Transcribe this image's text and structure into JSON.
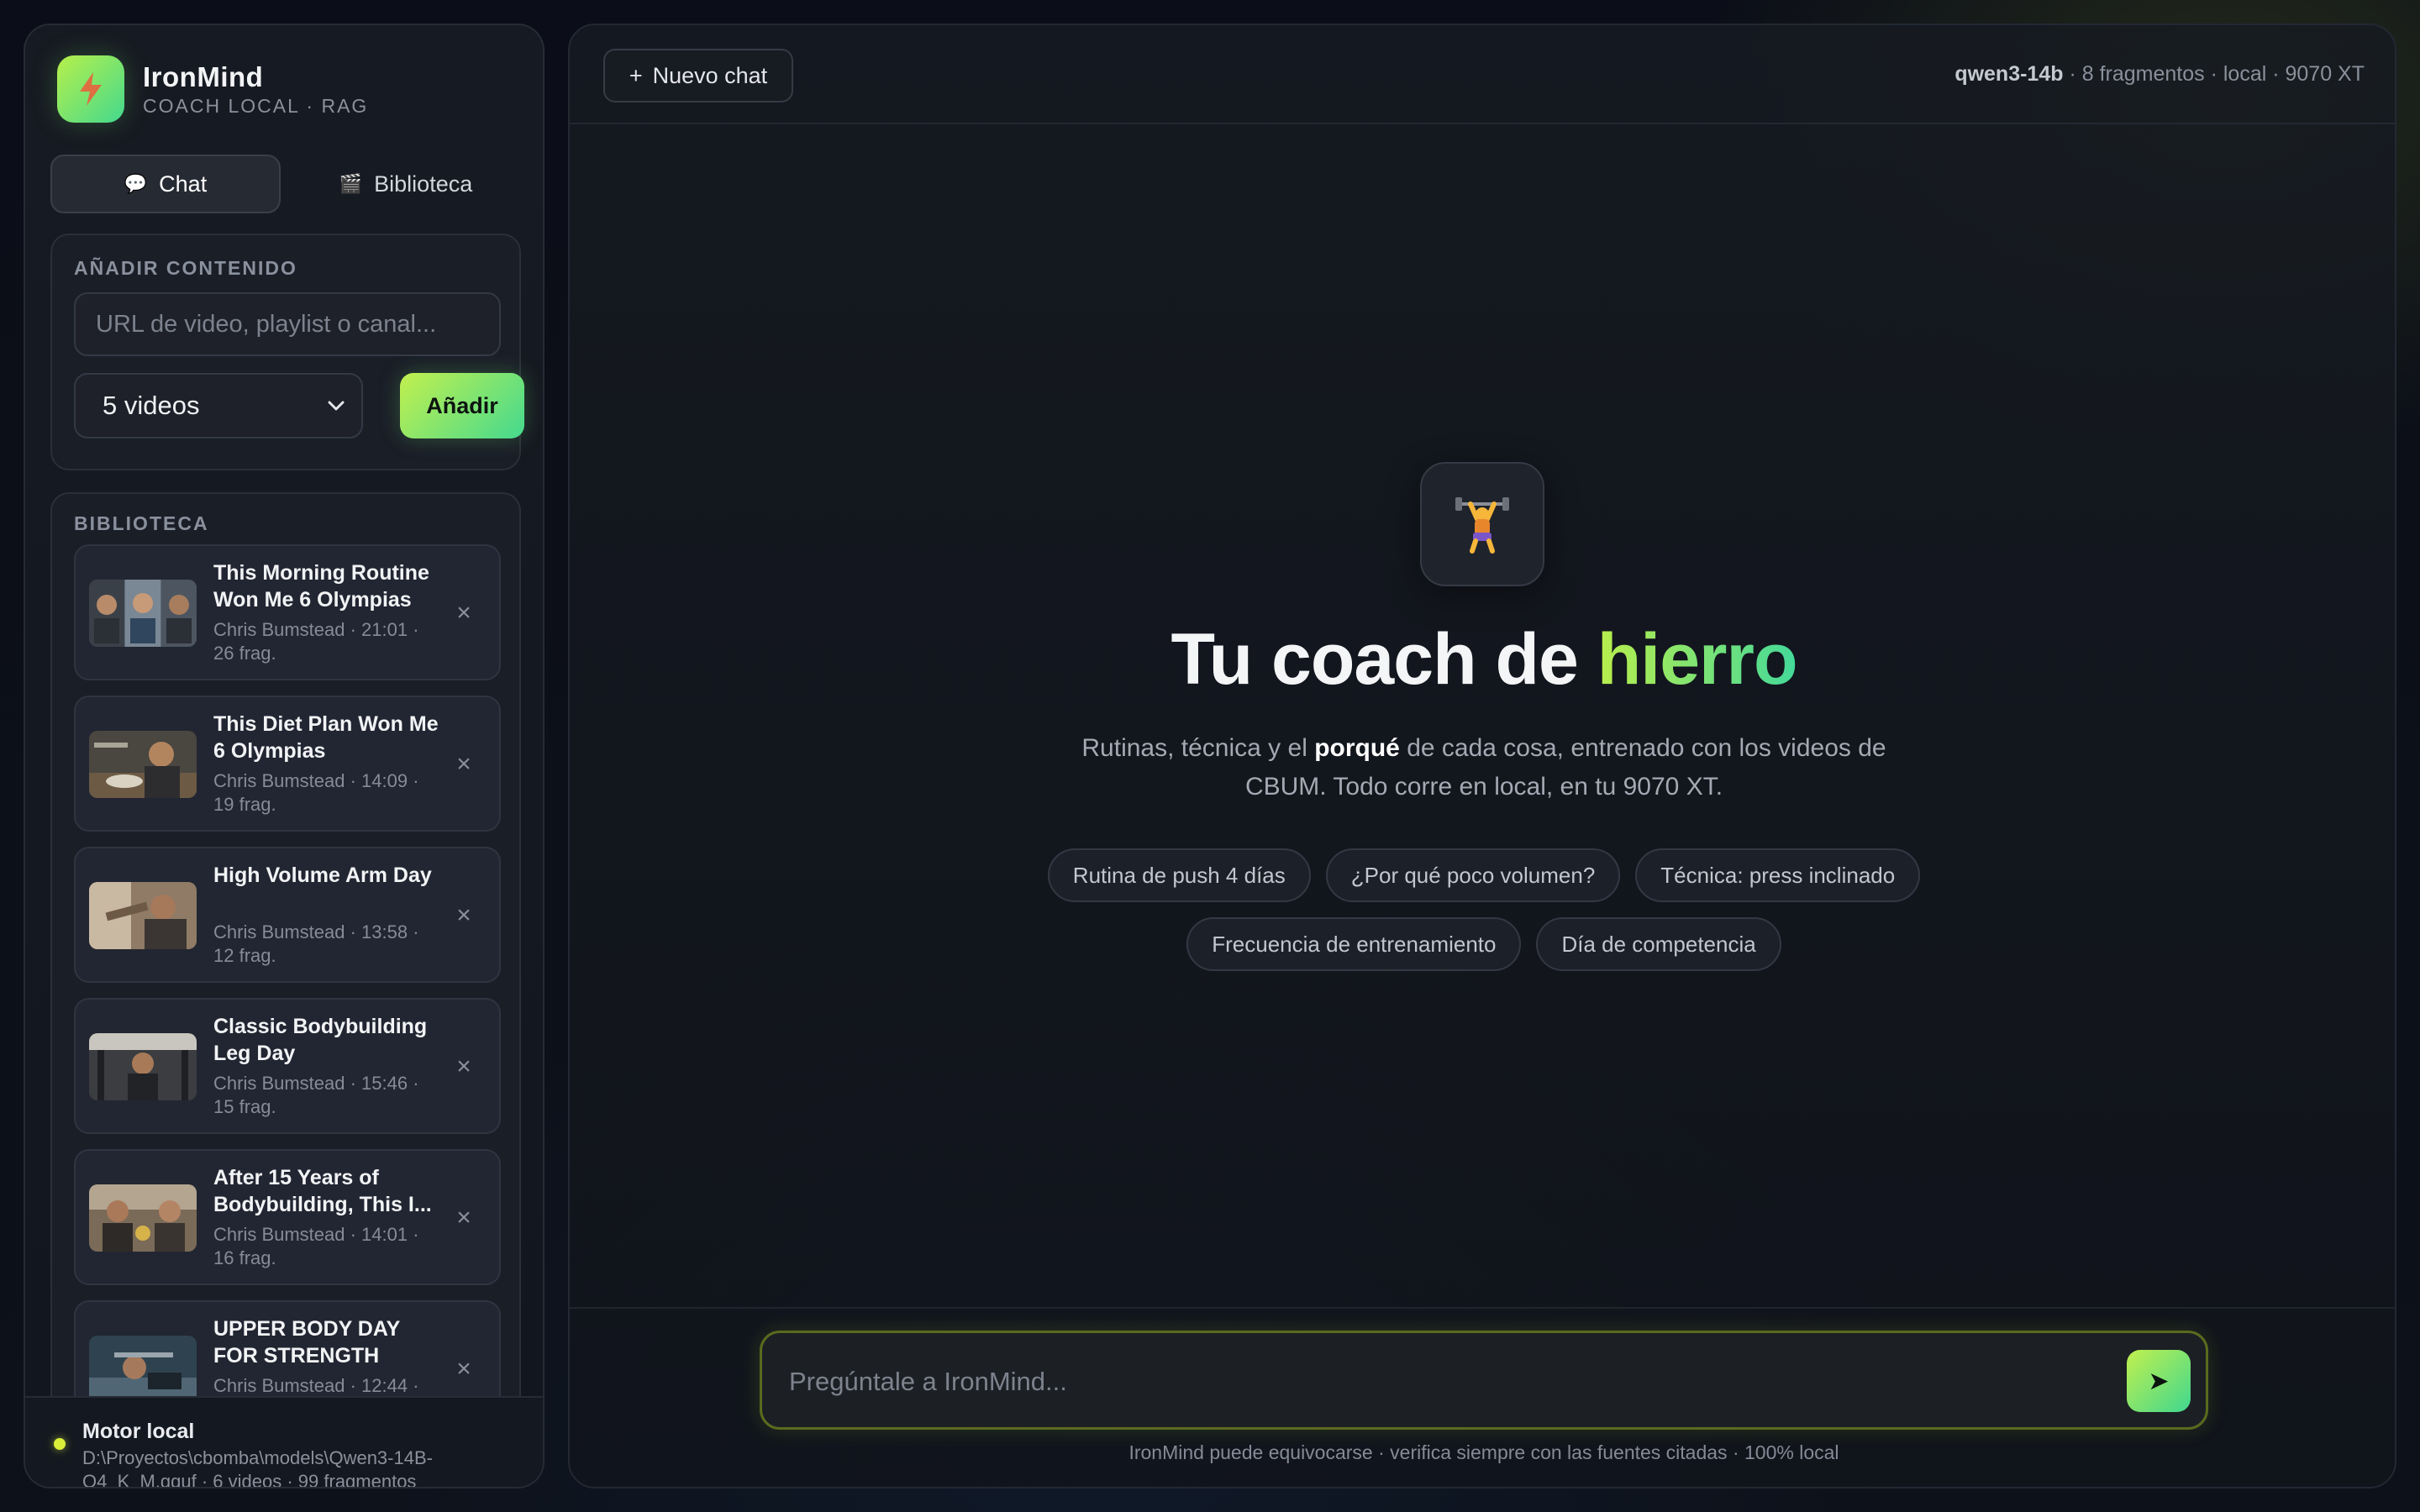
{
  "brand": {
    "name": "IronMind",
    "subtitle": "COACH LOCAL · RAG"
  },
  "tabs": [
    {
      "icon": "💬",
      "label": "Chat",
      "active": true
    },
    {
      "icon": "🎬",
      "label": "Biblioteca",
      "active": false
    }
  ],
  "add_content": {
    "label": "AÑADIR CONTENIDO",
    "url_placeholder": "URL de video, playlist o canal...",
    "url_value": "",
    "count_selected": "5 videos",
    "add_button": "Añadir"
  },
  "library": {
    "label": "BIBLIOTECA",
    "items": [
      {
        "title": "This Morning Routine Won Me 6 Olympias",
        "meta": "Chris Bumstead · 21:01 · 26 frag."
      },
      {
        "title": "This Diet Plan Won Me 6 Olympias",
        "meta": "Chris Bumstead · 14:09 · 19 frag."
      },
      {
        "title": "High Volume Arm Day",
        "meta": "Chris Bumstead · 13:58 · 12 frag."
      },
      {
        "title": "Classic Bodybuilding Leg Day",
        "meta": "Chris Bumstead · 15:46 · 15 frag."
      },
      {
        "title": "After 15 Years of Bodybuilding, This I...",
        "meta": "Chris Bumstead · 14:01 · 16 frag."
      },
      {
        "title": "UPPER BODY DAY FOR STRENGTH",
        "meta": "Chris Bumstead · 12:44 ·"
      }
    ],
    "close_glyph": "×"
  },
  "engine": {
    "title": "Motor local",
    "path": "D:\\Proyectos\\cbomba\\models\\Qwen3-14B-Q4_K_M.gguf · 6 videos · 99 fragmentos"
  },
  "topbar": {
    "new_chat": "Nuevo chat",
    "new_chat_icon": "+",
    "model": "qwen3-14b",
    "info": " · 8 fragmentos · local · 9070 XT"
  },
  "hero": {
    "icon": "🏋️",
    "title_main": "Tu coach de ",
    "title_accent": "hierro",
    "sub_before": "Rutinas, técnica y el ",
    "sub_bold": "porqué",
    "sub_after": " de cada cosa, entrenado con los videos de CBUM. Todo corre en local, en tu 9070 XT."
  },
  "suggestions_row1": [
    "Rutina de push 4 días",
    "¿Por qué poco volumen?",
    "Técnica: press inclinado"
  ],
  "suggestions_row2": [
    "Frecuencia de entrenamiento",
    "Día de competencia"
  ],
  "composer": {
    "placeholder": "Pregúntale a IronMind...",
    "value": "",
    "send_icon": "➤"
  },
  "disclaimer": "IronMind puede equivocarse · verifica siempre con las fuentes citadas · 100% local",
  "colors": {
    "accent_start": "#c2f04e",
    "accent_end": "#44d98f",
    "engine_dot": "#d9ef3a"
  }
}
